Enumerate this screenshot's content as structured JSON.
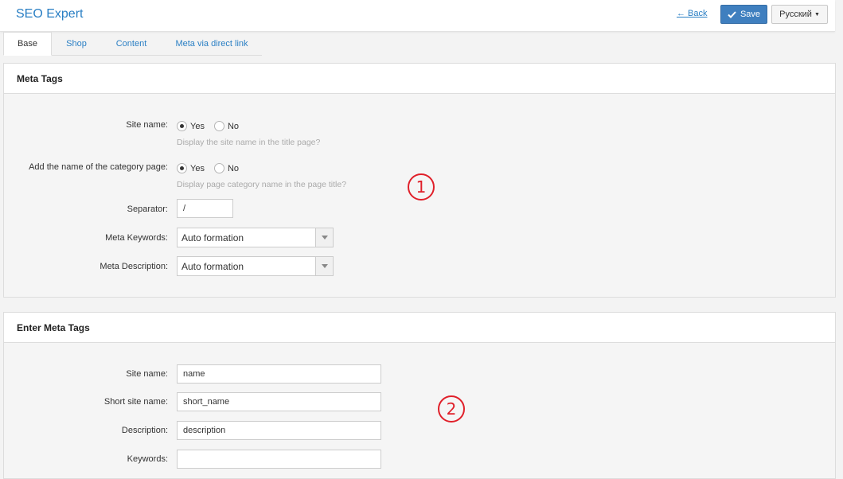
{
  "header": {
    "title": "SEO Expert",
    "back_label": "← Back",
    "save_label": "Save",
    "language": "Русский"
  },
  "tabs": [
    {
      "label": "Base",
      "active": true
    },
    {
      "label": "Shop",
      "active": false
    },
    {
      "label": "Content",
      "active": false
    },
    {
      "label": "Meta via direct link",
      "active": false
    }
  ],
  "meta_tags": {
    "title": "Meta Tags",
    "site_name": {
      "label": "Site name:",
      "yes": "Yes",
      "no": "No",
      "selected": "Yes",
      "hint": "Display the site name in the title page?"
    },
    "category_name": {
      "label": "Add the name of the category page:",
      "yes": "Yes",
      "no": "No",
      "selected": "Yes",
      "hint": "Display page category name in the page title?"
    },
    "separator": {
      "label": "Separator:",
      "value": "/"
    },
    "meta_keywords": {
      "label": "Meta Keywords:",
      "value": "Auto formation"
    },
    "meta_description": {
      "label": "Meta Description:",
      "value": "Auto formation"
    }
  },
  "enter_meta_tags": {
    "title": "Enter Meta Tags",
    "site_name": {
      "label": "Site name:",
      "value": "name"
    },
    "short_site_name": {
      "label": "Short site name:",
      "value": "short_name"
    },
    "description": {
      "label": "Description:",
      "value": "description"
    },
    "keywords": {
      "label": "Keywords:",
      "value": ""
    }
  },
  "annotations": {
    "marker_1": "1",
    "marker_2": "2",
    "color": "#e0202a"
  },
  "colors": {
    "accent": "#2a7fc4",
    "save_button": "#3f7fbf"
  }
}
